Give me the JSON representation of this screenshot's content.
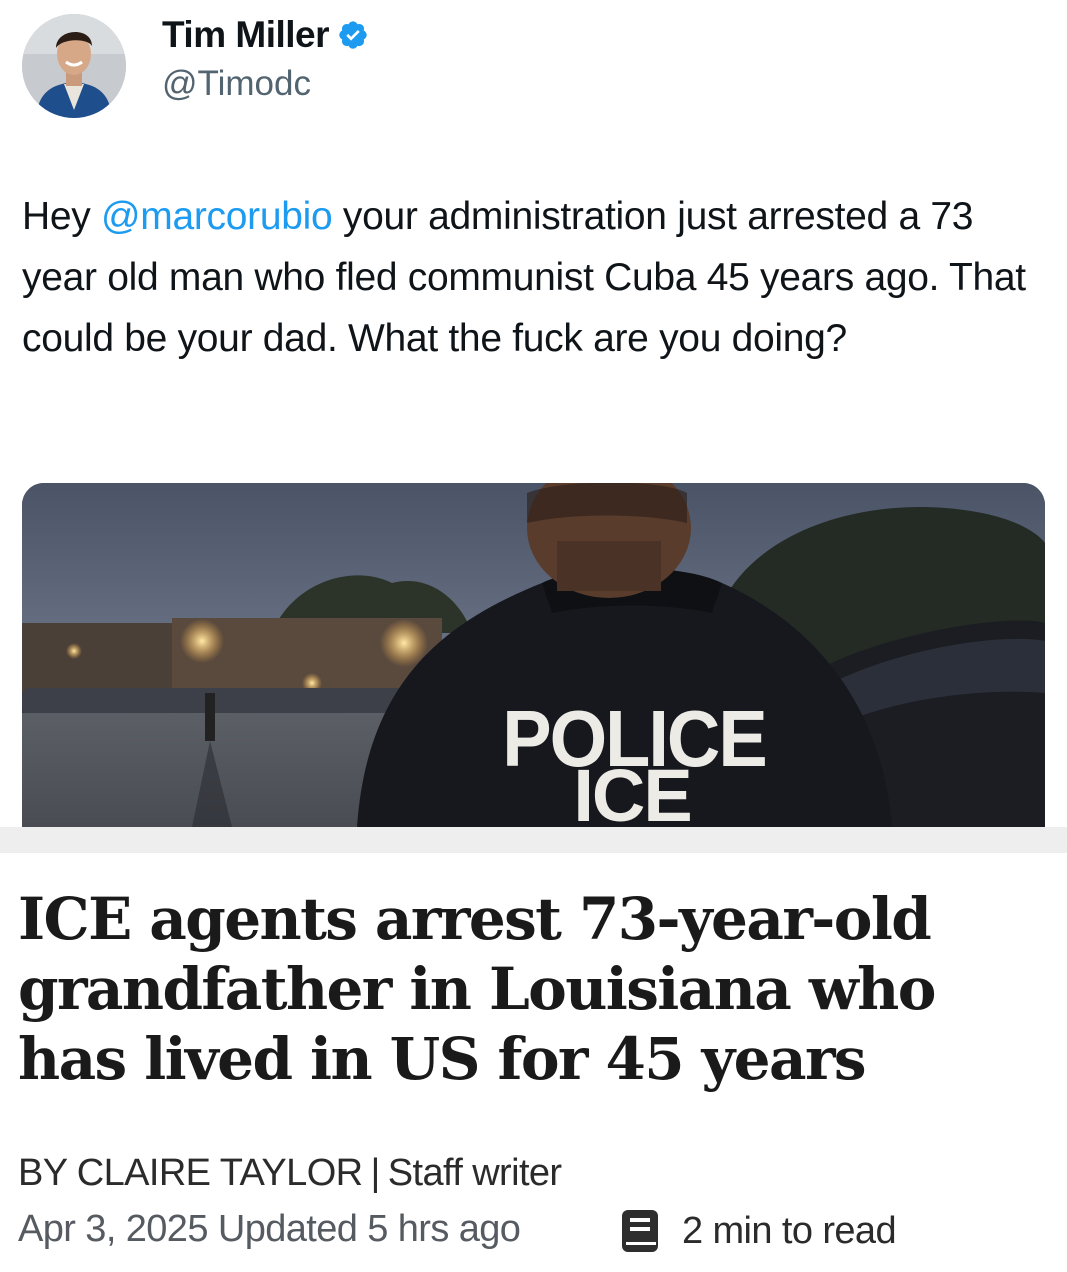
{
  "tweet": {
    "author_name": "Tim Miller",
    "author_handle": "@Timodc",
    "verified_icon": "verified-badge-icon",
    "text_before": "Hey ",
    "mention": "@marcorubio",
    "text_after": " your administration just arrested a 73 year old man who fled communist Cuba 45 years ago. That could be your dad. What the fuck are you doing?"
  },
  "media": {
    "patch_line1": "POLICE",
    "patch_line2": "ICE"
  },
  "article": {
    "headline": "ICE agents arrest 73-year-old grandfather in Louisiana who has lived in US for 45 years",
    "byline_author": "BY CLAIRE TAYLOR",
    "byline_separator": "|",
    "byline_role": "Staff writer",
    "date": "Apr 3, 2025",
    "updated": "Updated 5 hrs ago",
    "read_icon": "book-icon",
    "read_time": "2 min to read"
  },
  "colors": {
    "mention": "#1d9bf0",
    "verified": "#1d9bf0",
    "handle": "#536471"
  }
}
